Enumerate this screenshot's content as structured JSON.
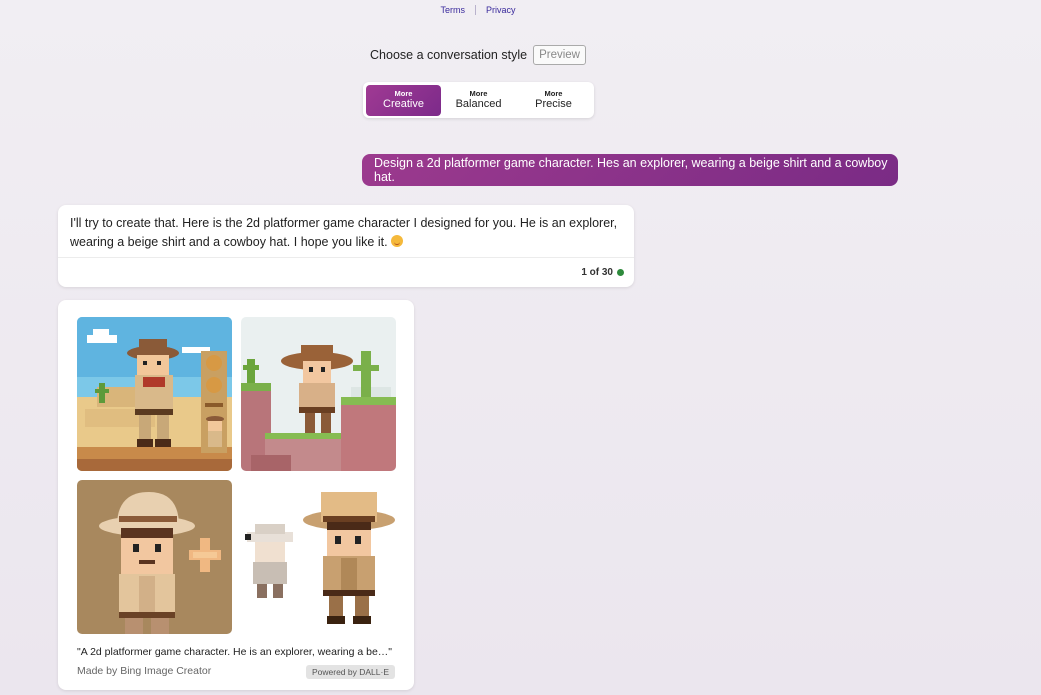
{
  "footer": {
    "terms": "Terms",
    "privacy": "Privacy"
  },
  "style_picker": {
    "label": "Choose a conversation style",
    "badge": "Preview",
    "options": [
      {
        "prefix": "More",
        "label": "Creative",
        "active": true
      },
      {
        "prefix": "More",
        "label": "Balanced",
        "active": false
      },
      {
        "prefix": "More",
        "label": "Precise",
        "active": false
      }
    ]
  },
  "user_message": "Design a 2d platformer game character. Hes an explorer, wearing a beige shirt and a cowboy hat.",
  "bot_message": {
    "text": "I'll try to create that. Here is the 2d platformer game character I designed for you. He is an explorer, wearing a beige shirt and a cowboy hat. I hope you like it.",
    "emoji": "smiling-face-icon",
    "counter": "1 of 30",
    "status_color": "#2e8a3c"
  },
  "image_card": {
    "caption": "\"A 2d platformer game character. He is an explorer, wearing a be…\"",
    "made_by": "Made by Bing Image Creator",
    "powered_by": "Powered by DALL·E",
    "images": [
      {
        "name": "explorer-desert-scene"
      },
      {
        "name": "explorer-platform-scene"
      },
      {
        "name": "explorer-portrait"
      },
      {
        "name": "explorer-sprite-sheet"
      }
    ]
  },
  "colors": {
    "accent": "#8a3190",
    "accent_dark": "#7a2b85",
    "link": "#3a2a9c"
  }
}
